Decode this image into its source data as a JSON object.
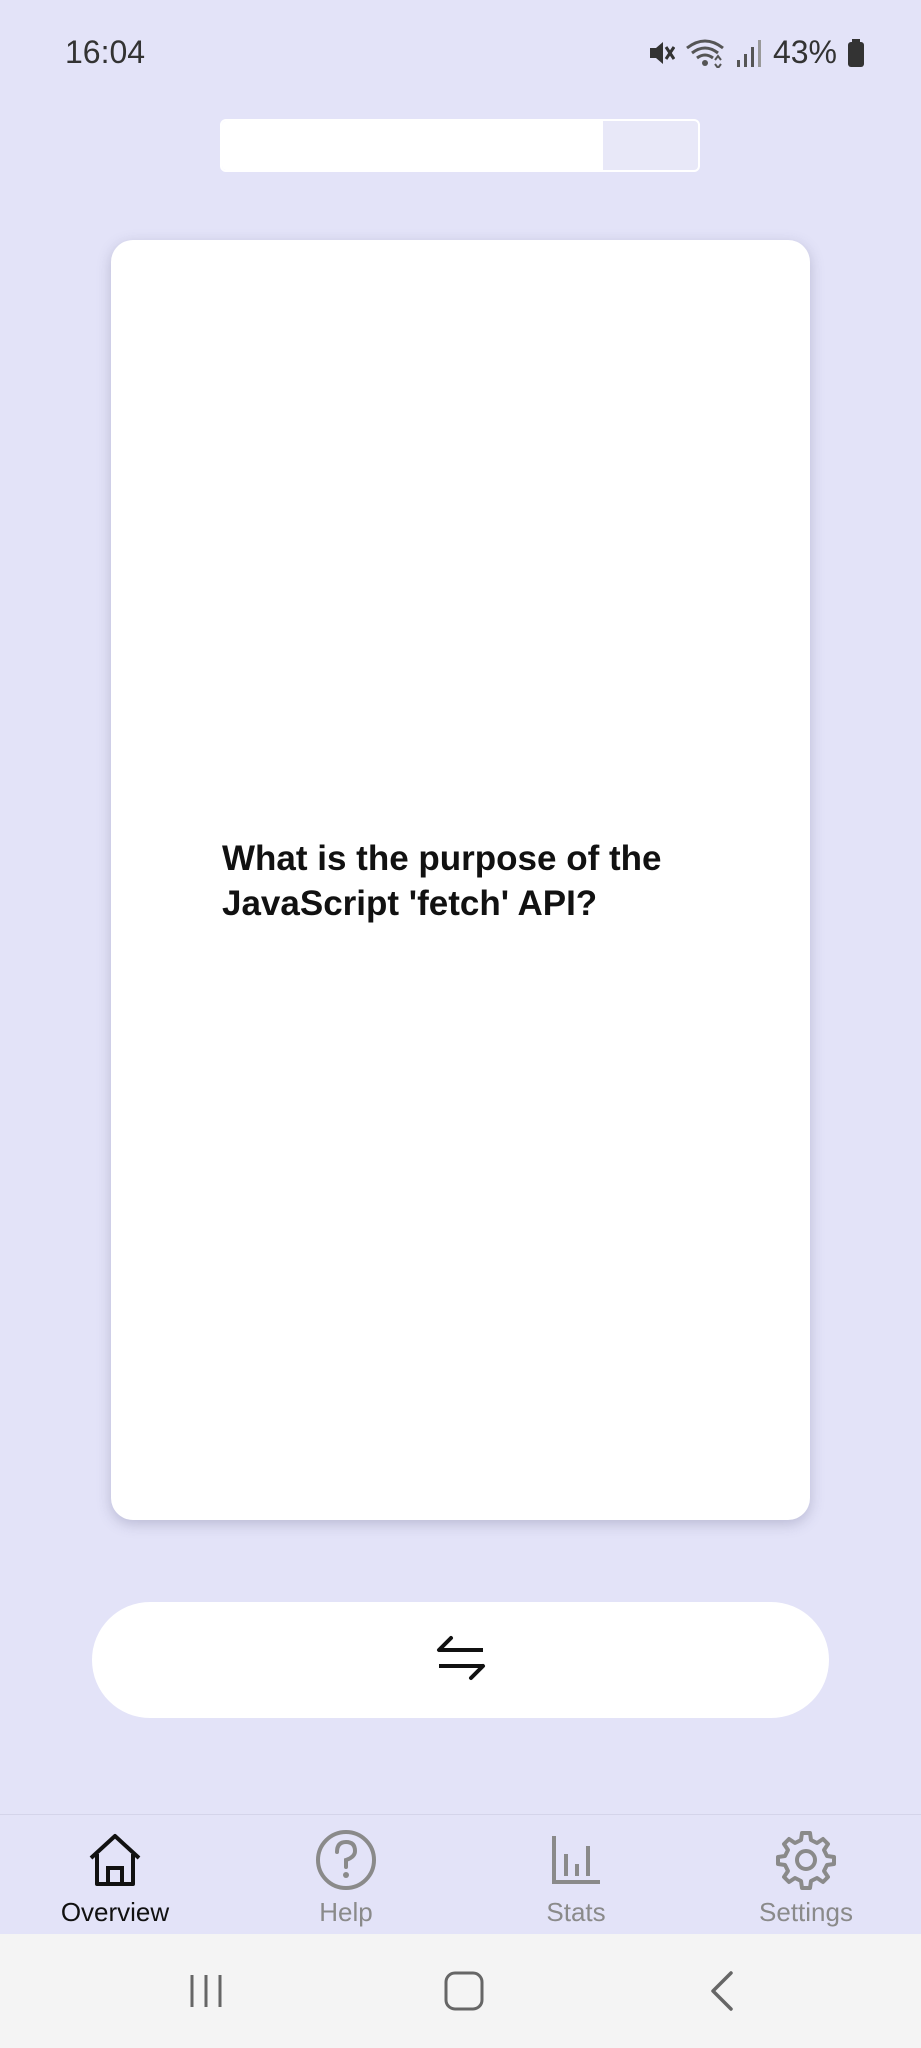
{
  "status_bar": {
    "time": "16:04",
    "battery_percent": "43%",
    "icons": [
      "mute-icon",
      "wifi-icon",
      "signal-icon",
      "battery-icon"
    ]
  },
  "progress": {
    "fraction": 0.8
  },
  "card": {
    "question": "What is the purpose of the JavaScript 'fetch' API?"
  },
  "flip_button": {
    "icon": "swap-arrows-icon"
  },
  "bottom_nav": {
    "items": [
      {
        "label": "Overview",
        "icon": "home-icon",
        "active": true
      },
      {
        "label": "Help",
        "icon": "help-icon",
        "active": false
      },
      {
        "label": "Stats",
        "icon": "stats-icon",
        "active": false
      },
      {
        "label": "Settings",
        "icon": "gear-icon",
        "active": false
      }
    ]
  },
  "system_nav": {
    "buttons": [
      "recents-icon",
      "home-button-icon",
      "back-icon"
    ]
  },
  "colors": {
    "background": "#E3E3F8",
    "card": "#FFFFFF",
    "active_label": "#111111",
    "inactive": "#8A8A8A"
  }
}
